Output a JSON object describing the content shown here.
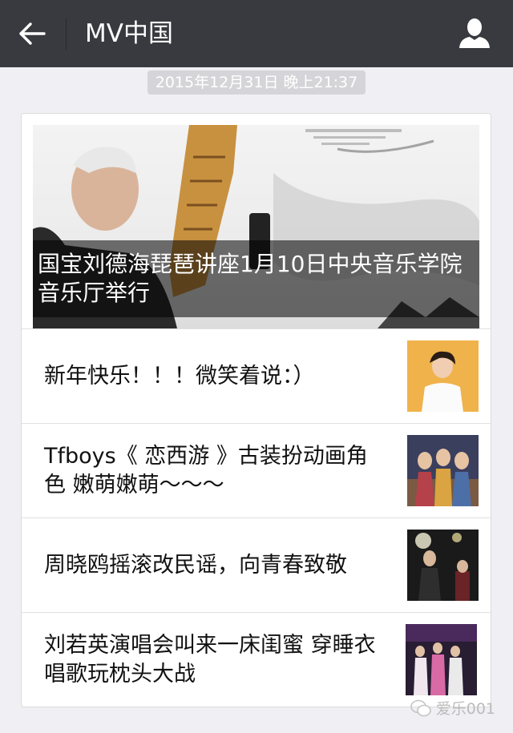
{
  "header": {
    "title": "MV中国",
    "back_icon": "arrow-left-icon",
    "profile_icon": "user-icon",
    "bg_color": "#393a3f"
  },
  "timestamp": "2015年12月31日 晚上21:37",
  "article": {
    "cover_title": "国宝刘德海琵琶讲座1月10日中央音乐学院音乐厅举行",
    "items": [
      {
        "title": "新年快乐！！！微笑着说：）"
      },
      {
        "title": "Tfboys《 恋西游 》古装扮动画角色 嫩萌嫩萌～～～"
      },
      {
        "title": "周晓鸥摇滚改民谣，向青春致敬"
      },
      {
        "title": "刘若英演唱会叫来一床闺蜜 穿睡衣唱歌玩枕头大战"
      }
    ]
  },
  "watermark": "爱乐001"
}
